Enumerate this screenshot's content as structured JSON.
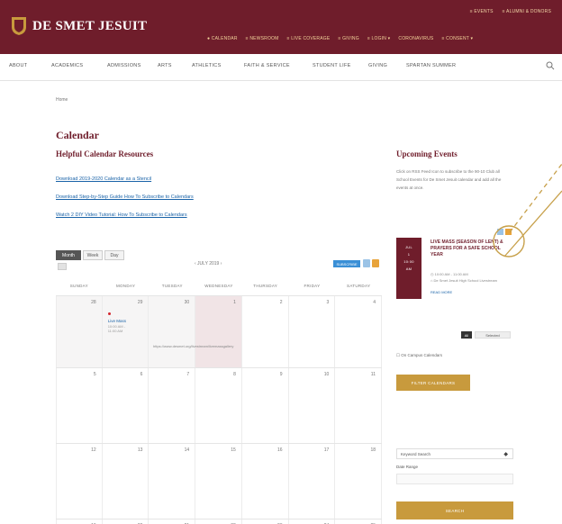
{
  "header": {
    "logo_text": "DE SMET JESUIT",
    "utility_links": [
      "≡ EVENTS",
      "≡ ALUMNI & DONORS"
    ],
    "top_links": [
      "● CALENDAR",
      "≡ NEWSROOM",
      "≡ LIVE COVERAGE",
      "≡ GIVING",
      "≡ LOGIN ▾",
      "CORONAVIRUS",
      "≡ CONSENT ▾"
    ]
  },
  "main_nav": [
    "ABOUT",
    "ACADEMICS",
    "ADMISSIONS",
    "ARTS",
    "ATHLETICS",
    "FAITH & SERVICE",
    "STUDENT LIFE",
    "GIVING",
    "SPARTAN SUMMER"
  ],
  "breadcrumb": "Home",
  "page_title": "Calendar",
  "resources": {
    "heading": "Helpful Calendar Resources",
    "links": [
      "Download 2019-2020 Calendar as a Stencil",
      "Download Step-by-Step Guide How To Subscribe to Calendars",
      "Watch 2 DIY Video Tutorial: How To Subscribe to Calendars"
    ]
  },
  "calendar": {
    "views": [
      "Month",
      "Week",
      "Day"
    ],
    "active_view": "Month",
    "month_label": "‹ JULY 2019 ›",
    "subscribe_label": "SUBSCRIBE",
    "days_of_week": [
      "SUNDAY",
      "MONDAY",
      "TUESDAY",
      "WEDNESDAY",
      "THURSDAY",
      "FRIDAY",
      "SATURDAY"
    ],
    "weeks": [
      [
        "28",
        "29",
        "30",
        "1",
        "2",
        "3",
        "4"
      ],
      [
        "5",
        "6",
        "7",
        "8",
        "9",
        "10",
        "11"
      ],
      [
        "12",
        "13",
        "14",
        "15",
        "16",
        "17",
        "18"
      ]
    ],
    "next_week_numbers": [
      "19",
      "20",
      "21",
      "22",
      "23",
      "24",
      "25"
    ],
    "event": {
      "title": "Live Mass",
      "time_start": "10:00 AM -",
      "time_end": "11:00 AM",
      "link": "https://www.desmet.org/livestream/livemassgallery"
    }
  },
  "sidebar": {
    "title": "Upcoming Events",
    "intro": "Click on RSS Feed Icon to subscribe to the 90-10 Club all School Events for De Smet Jesuit calendar and add all the events at once.",
    "event": {
      "date_lines": [
        "JUL",
        "1",
        "10:00",
        "AM"
      ],
      "title": "LIVE MASS (SEASON OF LENT) & PRAYERS FOR A SAFE SCHOOL YEAR",
      "time": "◷ 10:00 AM - 11:00 AM",
      "location": "⌂ De Smet Jesuit High School Livestream",
      "more": "READ MORE"
    },
    "toggle_dark": "All",
    "toggle_light": "Selected",
    "checkbox_label": "☐ On Campus Calendars",
    "filter_button": "FILTER CALENDARS",
    "select_label": "Keyword Search",
    "date_range_label": "Date Range",
    "search_button": "SEARCH"
  },
  "colors": {
    "brand": "#6f1d2b",
    "gold": "#c89a3d",
    "link": "#1a63a8",
    "annotation": "#c7a04a"
  }
}
